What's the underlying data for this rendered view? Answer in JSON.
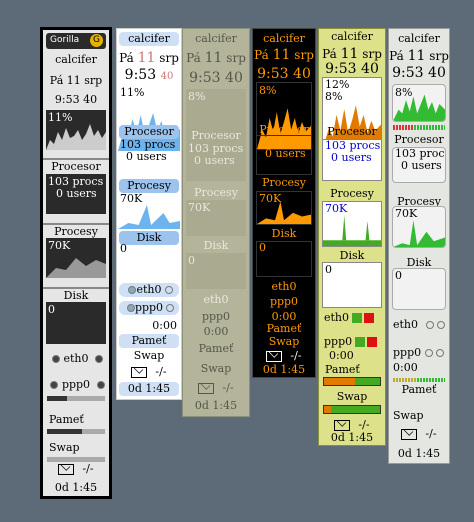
{
  "hostname": "calcifer",
  "date_day": "Pá",
  "date_num": "11",
  "date_month": "srp",
  "time_hm": "9:53",
  "time_s": "40",
  "cpu_label": "Procesor",
  "procs_line": "103 procs",
  "users_line": "0 users",
  "procesy_label": "Procesy",
  "disk_label": "Disk",
  "eth0_label": "eth0",
  "ppp0_label": "ppp0",
  "mem_label": "Pameť",
  "swap_label": "Swap",
  "mail_value": "-/-",
  "uptime": "0d 1:45",
  "net_rate": "0:00",
  "zero": "0",
  "themes": [
    {
      "name": "gorilla",
      "logo": "Gorilla",
      "cpu_pct": "11%",
      "cpu_pct2": "",
      "bg": "#e6e6e6",
      "fg": "#000000",
      "graph_bg": "#2a2a2a",
      "graph_fg": "#e8e8e8",
      "border": "#000000",
      "accent": "#333333",
      "cpu_graph_fill": 0.0,
      "procesy_value": "70K",
      "disk_value": "0"
    },
    {
      "name": "blue",
      "logo": "",
      "cpu_pct": "11%",
      "cpu_pct2": "",
      "bg": "#ffffff",
      "fg": "#000000",
      "graph_bg": "#ffffff",
      "graph_fg": "#5fa8e8",
      "border": "#dddddd",
      "accent": "#6b9fd8",
      "cpu_graph_fill": 0.0,
      "procesy_value": "70K",
      "disk_value": "0"
    },
    {
      "name": "khaki",
      "logo": "",
      "cpu_pct": "8%",
      "cpu_pct2": "",
      "bg": "#b3b49a",
      "fg": "#55574a",
      "graph_bg": "#a9aa90",
      "graph_fg": "#e9e9dc",
      "border": "#8e8f78",
      "accent": "#8e8f78",
      "cpu_graph_fill": 0.0,
      "procesy_value": "70K",
      "disk_value": "0"
    },
    {
      "name": "black-orange",
      "logo": "",
      "cpu_pct": "8%",
      "cpu_pct2": "",
      "bg": "#000000",
      "fg": "#ff9900",
      "graph_bg": "#000000",
      "graph_fg": "#ff9900",
      "border": "#444444",
      "accent": "#ff9900",
      "cpu_graph_fill": 0.0,
      "procesy_value": "70K",
      "disk_value": "0"
    },
    {
      "name": "yellow-green",
      "logo": "",
      "cpu_pct": "12%",
      "cpu_pct2": "8%",
      "bg": "#dde28a",
      "fg": "#000000",
      "graph_bg": "#ffffff",
      "graph_fg": "#e07b00",
      "border": "#8a8f3a",
      "accent": "#44aa22",
      "cpu_graph_fill": 0.0,
      "procesy_value": "70K",
      "disk_value": "0"
    },
    {
      "name": "grey",
      "logo": "",
      "cpu_pct": "8%",
      "cpu_pct2": "",
      "bg": "#e4e6e1",
      "fg": "#000000",
      "graph_bg": "#f2f2f2",
      "graph_fg": "#33bb33",
      "border": "#999999",
      "accent": "#777777",
      "cpu_graph_fill": 0.0,
      "procesy_value": "70K",
      "disk_value": "0"
    }
  ]
}
